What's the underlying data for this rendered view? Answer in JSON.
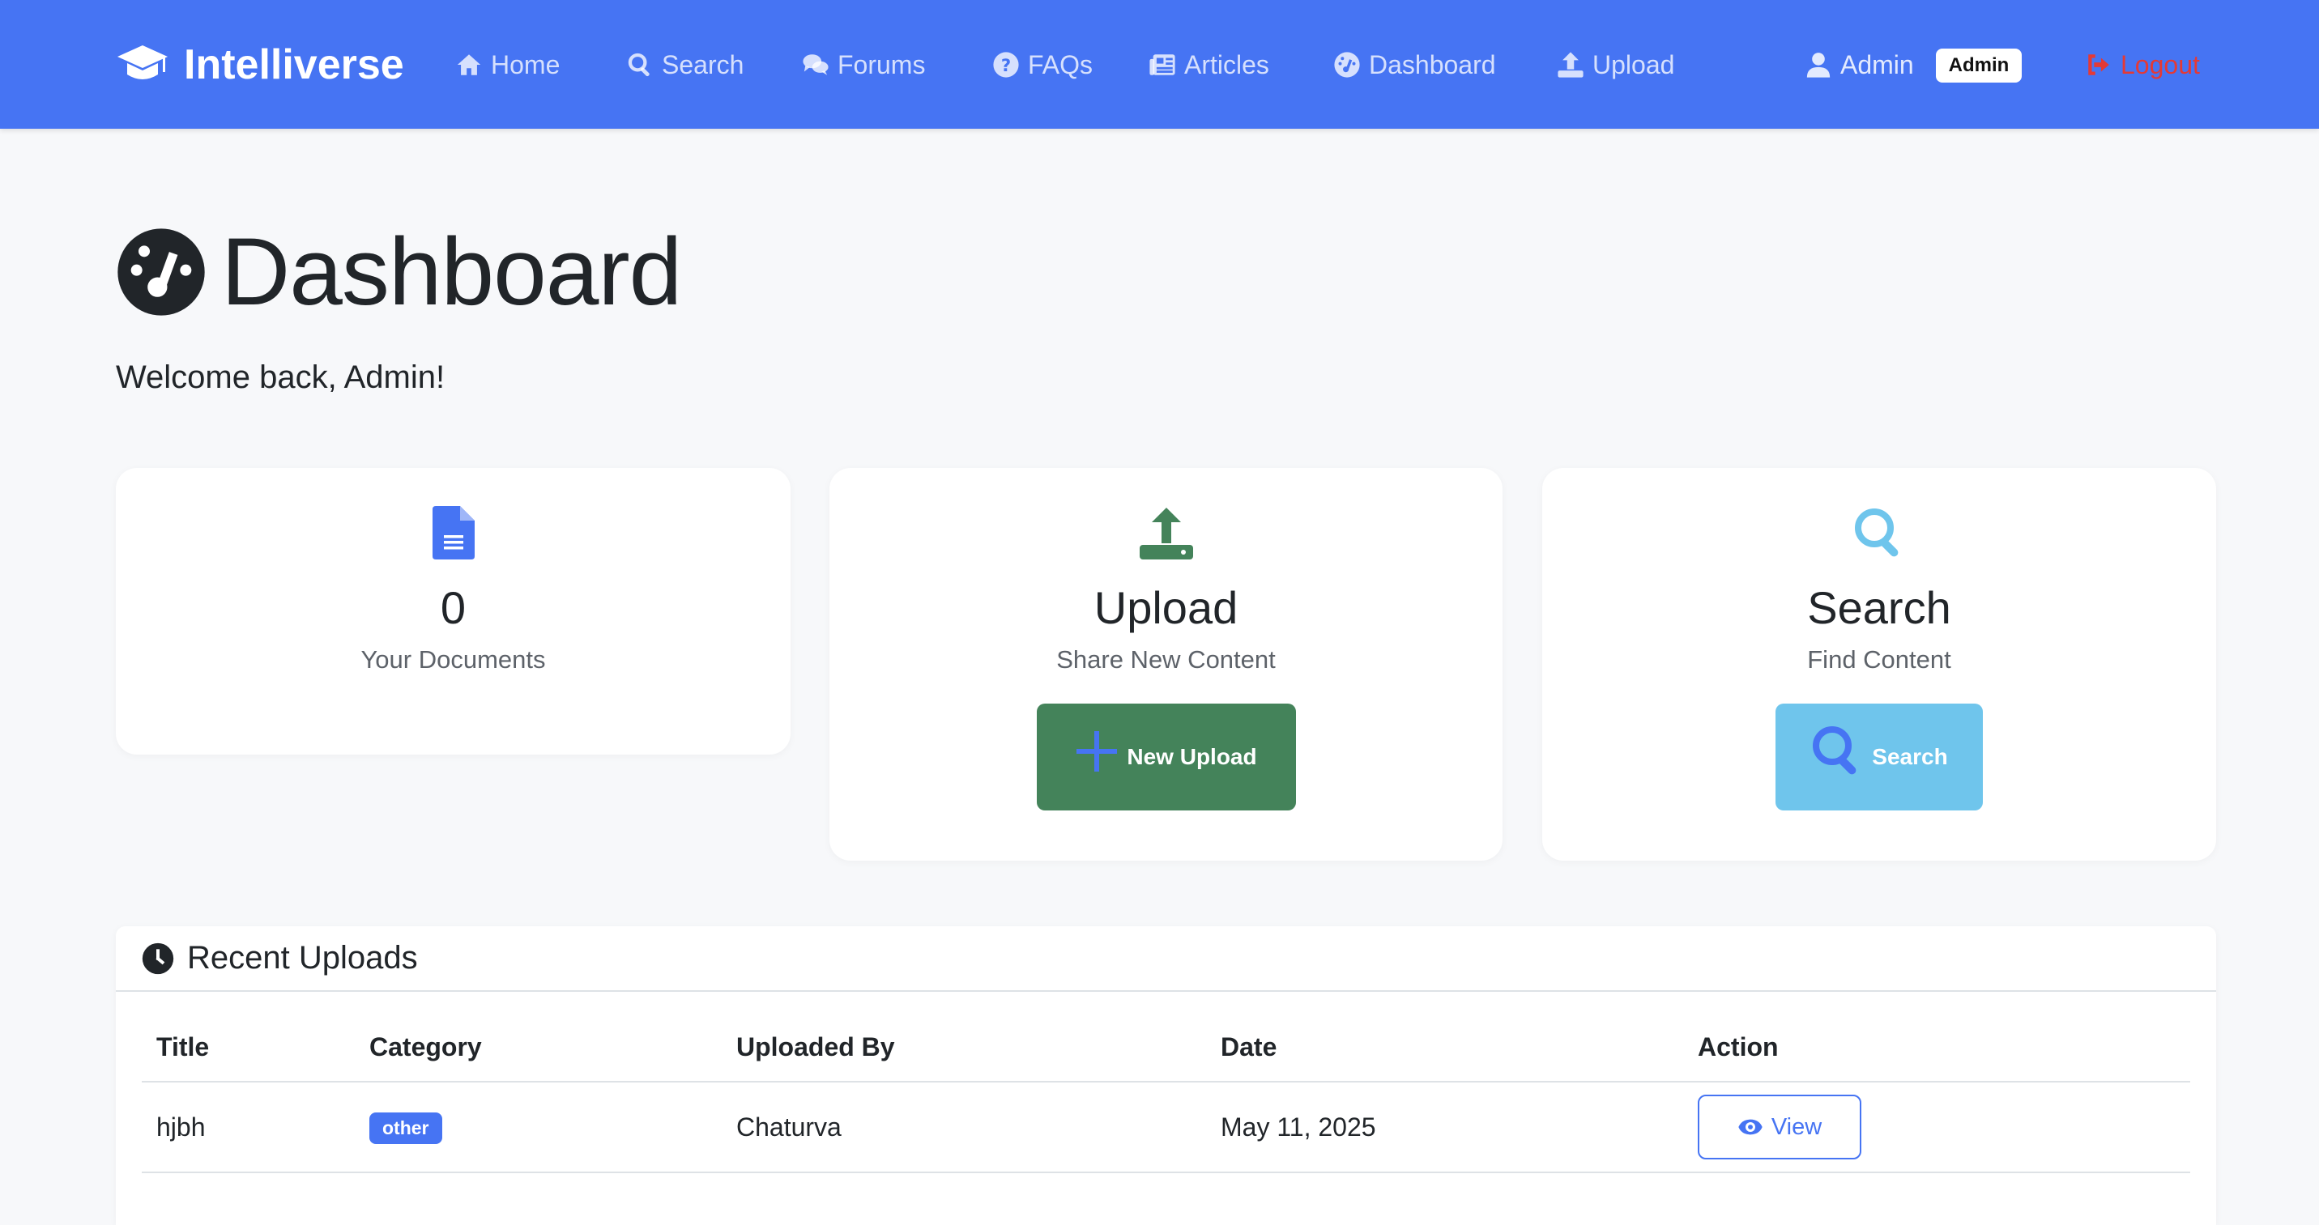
{
  "navbar": {
    "brand": "Intelliverse",
    "items": [
      {
        "label": "Home",
        "icon": "home-icon"
      },
      {
        "label": "Search",
        "icon": "search-icon"
      },
      {
        "label": "Forums",
        "icon": "comments-icon"
      },
      {
        "label": "FAQs",
        "icon": "question-circle-icon"
      },
      {
        "label": "Articles",
        "icon": "newspaper-icon"
      },
      {
        "label": "Dashboard",
        "icon": "gauge-icon"
      },
      {
        "label": "Upload",
        "icon": "upload-icon"
      }
    ],
    "user": {
      "name": "Admin",
      "role_badge": "Admin",
      "icon": "user-icon"
    },
    "logout": {
      "label": "Logout",
      "icon": "sign-out-icon"
    }
  },
  "header": {
    "title": "Dashboard",
    "welcome": "Welcome back, Admin!"
  },
  "cards": {
    "documents": {
      "value": "0",
      "label": "Your Documents",
      "icon": "document-icon"
    },
    "upload": {
      "title": "Upload",
      "subtitle": "Share New Content",
      "button_label": "New Upload",
      "icon": "upload-tray-icon"
    },
    "search": {
      "title": "Search",
      "subtitle": "Find Content",
      "button_label": "Search",
      "icon": "search-icon"
    }
  },
  "recent_uploads": {
    "title": "Recent Uploads",
    "columns": [
      "Title",
      "Category",
      "Uploaded By",
      "Date",
      "Action"
    ],
    "rows": [
      {
        "title": "hjbh",
        "category": "other",
        "uploaded_by": "Chaturva",
        "date": "May 11, 2025",
        "action": "View"
      }
    ]
  },
  "colors": {
    "primary": "#4674f3",
    "success": "#44835a",
    "info": "#6fc5ec",
    "danger": "#e53935",
    "background": "#f7f8fa"
  }
}
